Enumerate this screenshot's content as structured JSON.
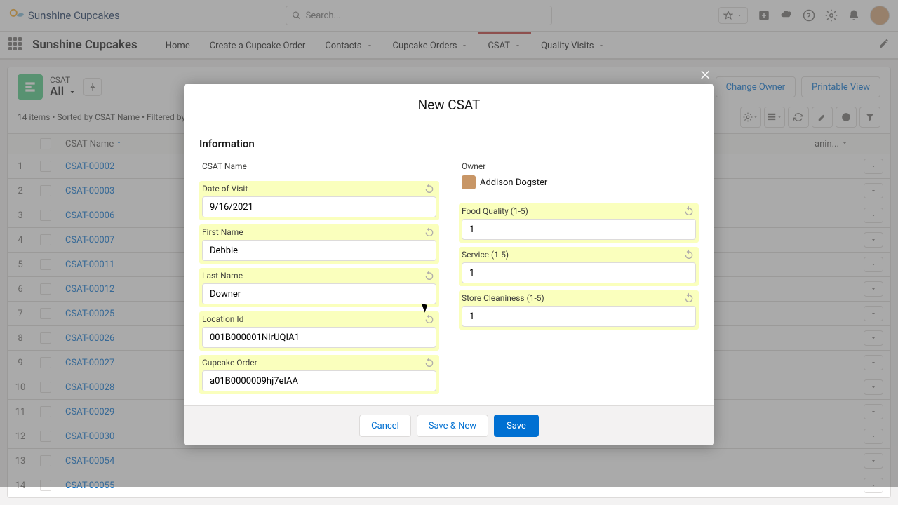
{
  "header": {
    "brand": "Sunshine Cupcakes",
    "search_ph": "Search..."
  },
  "nav": {
    "app": "Sunshine Cupcakes",
    "tabs": [
      "Home",
      "Create a Cupcake Order",
      "Contacts",
      "Cupcake Orders",
      "CSAT",
      "Quality Visits"
    ],
    "active": 4
  },
  "list": {
    "object": "CSAT",
    "view": "All",
    "meta": "14 items • Sorted by CSAT Name • Filtered by",
    "actions": {
      "change_owner": "Change Owner",
      "printable": "Printable View"
    },
    "col1": "CSAT Name",
    "col_last": "anin...",
    "rows": [
      "CSAT-00002",
      "CSAT-00003",
      "CSAT-00006",
      "CSAT-00007",
      "CSAT-00011",
      "CSAT-00012",
      "CSAT-00025",
      "CSAT-00026",
      "CSAT-00027",
      "CSAT-00028",
      "CSAT-00029",
      "CSAT-00030",
      "CSAT-00054",
      "CSAT-00055"
    ]
  },
  "modal": {
    "title": "New CSAT",
    "section": "Information",
    "left": {
      "csat_name_lbl": "CSAT Name",
      "date_lbl": "Date of Visit",
      "date_val": "9/16/2021",
      "fn_lbl": "First Name",
      "fn_val": "Debbie",
      "ln_lbl": "Last Name",
      "ln_val": "Downer",
      "loc_lbl": "Location Id",
      "loc_val": "001B000001NIrUQIA1",
      "ord_lbl": "Cupcake Order",
      "ord_val": "a01B0000009hj7eIAA"
    },
    "right": {
      "owner_lbl": "Owner",
      "owner_val": "Addison Dogster",
      "fq_lbl": "Food Quality (1-5)",
      "fq_val": "1",
      "sv_lbl": "Service (1-5)",
      "sv_val": "1",
      "sc_lbl": "Store Cleaniness (1-5)",
      "sc_val": "1"
    },
    "buttons": {
      "cancel": "Cancel",
      "save_new": "Save & New",
      "save": "Save"
    }
  }
}
